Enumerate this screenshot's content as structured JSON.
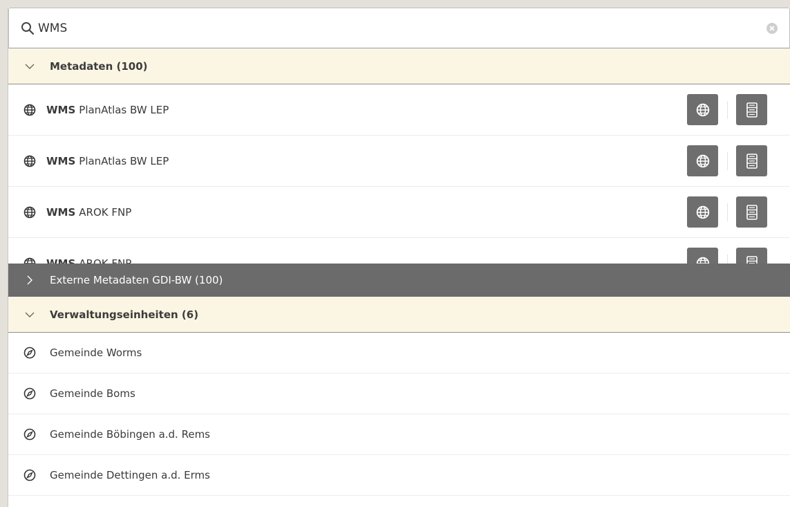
{
  "search": {
    "value": "WMS",
    "icon": "search-icon",
    "clear_icon": "clear-icon"
  },
  "groups": {
    "metadata": {
      "title": "Metadaten (100)",
      "expanded": true,
      "items": [
        {
          "keyword": "WMS",
          "name": "PlanAtlas BW LEP"
        },
        {
          "keyword": "WMS",
          "name": "PlanAtlas BW LEP"
        },
        {
          "keyword": "WMS",
          "name": "AROK FNP"
        },
        {
          "keyword": "WMS",
          "name": "AROK FNP"
        }
      ]
    },
    "external": {
      "title": "Externe Metadaten GDI-BW (100)",
      "expanded": false
    },
    "admin": {
      "title": "Verwaltungseinheiten (6)",
      "expanded": true,
      "items": [
        {
          "name": "Gemeinde Worms"
        },
        {
          "name": "Gemeinde Boms"
        },
        {
          "name": "Gemeinde Böbingen a.d. Rems"
        },
        {
          "name": "Gemeinde Dettingen a.d. Erms"
        }
      ]
    }
  },
  "colors": {
    "header_bg": "#fbf6e3",
    "collapsed_header_bg": "#6b6b6b",
    "action_button_bg": "#6e6e6e"
  }
}
